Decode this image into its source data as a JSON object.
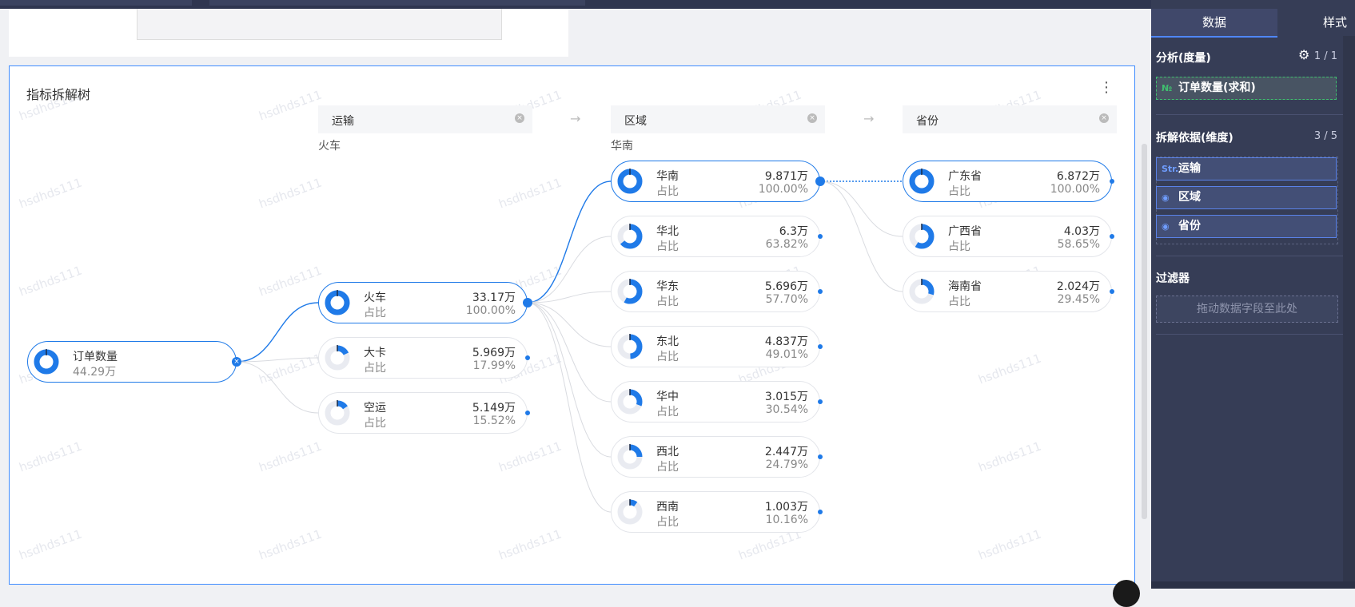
{
  "card": {
    "title": "指标拆解树"
  },
  "watermark": "hsdhds111",
  "levels": [
    {
      "label": "运输",
      "path": "火车"
    },
    {
      "label": "区域",
      "path": "华南"
    },
    {
      "label": "省份",
      "path": ""
    }
  ],
  "nodes": [
    {
      "id": "root",
      "name": "订单数量",
      "value": "44.29万",
      "sub": "",
      "pct": "",
      "ratio": 1.0,
      "selected": true
    },
    {
      "id": "t1",
      "name": "火车",
      "value": "33.17万",
      "sub": "占比",
      "pct": "100.00%",
      "ratio": 1.0,
      "selected": true
    },
    {
      "id": "t2",
      "name": "大卡",
      "value": "5.969万",
      "sub": "占比",
      "pct": "17.99%",
      "ratio": 0.1799,
      "selected": false
    },
    {
      "id": "t3",
      "name": "空运",
      "value": "5.149万",
      "sub": "占比",
      "pct": "15.52%",
      "ratio": 0.1552,
      "selected": false
    },
    {
      "id": "r1",
      "name": "华南",
      "value": "9.871万",
      "sub": "占比",
      "pct": "100.00%",
      "ratio": 1.0,
      "selected": true
    },
    {
      "id": "r2",
      "name": "华北",
      "value": "6.3万",
      "sub": "占比",
      "pct": "63.82%",
      "ratio": 0.6382,
      "selected": false
    },
    {
      "id": "r3",
      "name": "华东",
      "value": "5.696万",
      "sub": "占比",
      "pct": "57.70%",
      "ratio": 0.577,
      "selected": false
    },
    {
      "id": "r4",
      "name": "东北",
      "value": "4.837万",
      "sub": "占比",
      "pct": "49.01%",
      "ratio": 0.4901,
      "selected": false
    },
    {
      "id": "r5",
      "name": "华中",
      "value": "3.015万",
      "sub": "占比",
      "pct": "30.54%",
      "ratio": 0.3054,
      "selected": false
    },
    {
      "id": "r6",
      "name": "西北",
      "value": "2.447万",
      "sub": "占比",
      "pct": "24.79%",
      "ratio": 0.2479,
      "selected": false
    },
    {
      "id": "r7",
      "name": "西南",
      "value": "1.003万",
      "sub": "占比",
      "pct": "10.16%",
      "ratio": 0.1016,
      "selected": false
    },
    {
      "id": "p1",
      "name": "广东省",
      "value": "6.872万",
      "sub": "占比",
      "pct": "100.00%",
      "ratio": 1.0,
      "selected": true
    },
    {
      "id": "p2",
      "name": "广西省",
      "value": "4.03万",
      "sub": "占比",
      "pct": "58.65%",
      "ratio": 0.5865,
      "selected": false
    },
    {
      "id": "p3",
      "name": "海南省",
      "value": "2.024万",
      "sub": "占比",
      "pct": "29.45%",
      "ratio": 0.2945,
      "selected": false
    }
  ],
  "colors": {
    "accent": "#1f7ae8",
    "ring_bg": "#e9ebf1",
    "link": "#d9dbe0"
  },
  "panel": {
    "tabs": [
      "数据",
      "样式"
    ],
    "measure_title": "分析(度量)",
    "measure_count": "1 / 1",
    "measure_tag": "№",
    "measure_field": "订单数量(求和)",
    "dim_title": "拆解依据(维度)",
    "dim_count": "3 / 5",
    "dims": [
      {
        "tag": "Str.",
        "label": "运输",
        "icon": "text-type-icon"
      },
      {
        "tag": "◉",
        "label": "区域",
        "icon": "geo-pin-icon"
      },
      {
        "tag": "◉",
        "label": "省份",
        "icon": "geo-pin-icon"
      }
    ],
    "filter_title": "过滤器",
    "filter_drop": "拖动数据字段至此处"
  }
}
